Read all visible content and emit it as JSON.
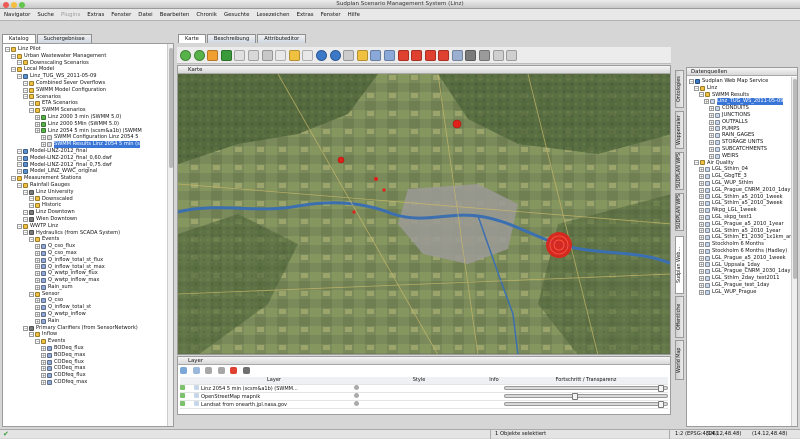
{
  "window": {
    "title": "Sudplan Scenario Management System (Linz)"
  },
  "menu": [
    {
      "label": "Navigator",
      "enabled": true
    },
    {
      "label": "Suche",
      "enabled": true
    },
    {
      "label": "Plugins",
      "enabled": false
    },
    {
      "label": "Extras",
      "enabled": true
    },
    {
      "label": "Fenster",
      "enabled": true
    },
    {
      "label": "Datei",
      "enabled": true
    },
    {
      "label": "Bearbeiten",
      "enabled": true
    },
    {
      "label": "Chronik",
      "enabled": true
    },
    {
      "label": "Gesuchte",
      "enabled": true
    },
    {
      "label": "Lesezeichen",
      "enabled": true
    },
    {
      "label": "Extras",
      "enabled": true
    },
    {
      "label": "Fenster",
      "enabled": true
    },
    {
      "label": "Hilfe",
      "enabled": true
    }
  ],
  "left_tabs": [
    {
      "label": "Katalog"
    },
    {
      "label": "Suchergebnisse"
    }
  ],
  "catalog_tree": [
    {
      "label": "Linz Pilot",
      "level": 0,
      "icon": "folder-icon"
    },
    {
      "label": "Urban Wastewater Management",
      "level": 1,
      "icon": "folder-icon"
    },
    {
      "label": "Downscaling Scenarios",
      "level": 2,
      "icon": "folder-icon"
    },
    {
      "label": "Local Model",
      "level": 1,
      "icon": "folder-icon"
    },
    {
      "label": "Linz_TUG_WS_2011-05-09",
      "level": 2,
      "icon": "model-icon"
    },
    {
      "label": "Combined Sever Overflows",
      "level": 3,
      "icon": "folder-icon"
    },
    {
      "label": "SWMM Model Configuration",
      "level": 3,
      "icon": "folder-icon"
    },
    {
      "label": "Scenarios",
      "level": 3,
      "icon": "folder-icon"
    },
    {
      "label": "ETA Scenarios",
      "level": 4,
      "icon": "folder-icon"
    },
    {
      "label": "SWMM Scenarios",
      "level": 4,
      "icon": "folder-icon"
    },
    {
      "label": "Linz 2000 3 min (SWMM 5.0)",
      "level": 5,
      "icon": "scenario-icon"
    },
    {
      "label": "Linz 2000 5Min (SWMM 5.0)",
      "level": 5,
      "icon": "scenario-icon"
    },
    {
      "label": "Linz 2054 5 min (scsm&a1b) (SWMM",
      "level": 5,
      "icon": "scenario-icon"
    },
    {
      "label": "SWMM Configuration Linz 2054 5",
      "level": 6,
      "icon": "doc-icon"
    },
    {
      "label": "SWMM Results Linz 2054 5 min (s",
      "level": 6,
      "icon": "doc-icon",
      "selected": true
    },
    {
      "label": "Model-LINZ-2012_final",
      "level": 2,
      "icon": "model-icon"
    },
    {
      "label": "Model-LINZ-2012_final_0,60.dwf",
      "level": 2,
      "icon": "model-icon"
    },
    {
      "label": "Model-LINZ-2012_final_0,75.dwf",
      "level": 2,
      "icon": "model-icon"
    },
    {
      "label": "Model_LINZ_WWC_original",
      "level": 2,
      "icon": "model-icon"
    },
    {
      "label": "Measurement Stations",
      "level": 1,
      "icon": "folder-icon"
    },
    {
      "label": "Rainfall Gauges",
      "level": 2,
      "icon": "folder-icon"
    },
    {
      "label": "Linz University",
      "level": 3,
      "icon": "gauge-icon"
    },
    {
      "label": "Downscaled",
      "level": 4,
      "icon": "folder-icon"
    },
    {
      "label": "Historic",
      "level": 4,
      "icon": "folder-icon"
    },
    {
      "label": "Linz Downtown",
      "level": 3,
      "icon": "gauge-icon"
    },
    {
      "label": "Wien Downtown",
      "level": 3,
      "icon": "gauge-icon"
    },
    {
      "label": "WWTP Linz",
      "level": 2,
      "icon": "folder-icon"
    },
    {
      "label": "Hydraulics (from SCADA System)",
      "level": 3,
      "icon": "gauge-icon"
    },
    {
      "label": "Events",
      "level": 4,
      "icon": "folder-icon"
    },
    {
      "label": "Q_cso_flux",
      "level": 5,
      "icon": "series-icon"
    },
    {
      "label": "Q_cso_max",
      "level": 5,
      "icon": "series-icon"
    },
    {
      "label": "Q_inflow_total_st_flux",
      "level": 5,
      "icon": "series-icon"
    },
    {
      "label": "Q_inflow_total_st_max",
      "level": 5,
      "icon": "series-icon"
    },
    {
      "label": "Q_wwtp_inflow_flux",
      "level": 5,
      "icon": "series-icon"
    },
    {
      "label": "Q_wwtp_inflow_max",
      "level": 5,
      "icon": "series-icon"
    },
    {
      "label": "Rain_sum",
      "level": 5,
      "icon": "series-icon"
    },
    {
      "label": "Sensor",
      "level": 4,
      "icon": "folder-icon"
    },
    {
      "label": "Q_cso",
      "level": 5,
      "icon": "series-icon"
    },
    {
      "label": "Q_inflow_total_st",
      "level": 5,
      "icon": "series-icon"
    },
    {
      "label": "Q_wwtp_inflow",
      "level": 5,
      "icon": "series-icon"
    },
    {
      "label": "Rain",
      "level": 5,
      "icon": "series-icon"
    },
    {
      "label": "Primary Clarifiers (from SensorNetwork)",
      "level": 3,
      "icon": "gauge-icon"
    },
    {
      "label": "Inflow",
      "level": 4,
      "icon": "folder-icon"
    },
    {
      "label": "Events",
      "level": 5,
      "icon": "folder-icon"
    },
    {
      "label": "BODeq_flux",
      "level": 6,
      "icon": "series-icon"
    },
    {
      "label": "BODeq_max",
      "level": 6,
      "icon": "series-icon"
    },
    {
      "label": "CODeq_flux",
      "level": 6,
      "icon": "series-icon"
    },
    {
      "label": "CODeq_max",
      "level": 6,
      "icon": "series-icon"
    },
    {
      "label": "CODfeq_flux",
      "level": 6,
      "icon": "series-icon"
    },
    {
      "label": "CODfeq_max",
      "level": 6,
      "icon": "series-icon"
    }
  ],
  "center_tabs": [
    {
      "label": "Karte"
    },
    {
      "label": "Beschreibung"
    },
    {
      "label": "Attributeditor"
    }
  ],
  "toolbar_icons": [
    "back-icon",
    "forward-icon",
    "home-icon",
    "refresh-icon",
    "print-icon",
    "copy-icon",
    "search-icon",
    "zoom-icon",
    "pan-icon",
    "select-icon",
    "info-icon",
    "globe-icon",
    "zoom-in-icon",
    "feature-edit-icon",
    "measure-icon",
    "attribute-icon",
    "new-point-icon",
    "new-line-icon",
    "add-icon",
    "remove-icon",
    "draw-icon",
    "snap-icon",
    "node-icon",
    "undo-icon",
    "redo-icon"
  ],
  "map": {
    "title": "Karte"
  },
  "layer_panel": {
    "title": "Layer",
    "columns": [
      "Layer",
      "Style",
      "Info",
      "Fortschritt / Transparenz"
    ],
    "rows": [
      {
        "name": "Linz 2054 5 min (scsm&a1b) (SWMM...",
        "transparency": 0.98
      },
      {
        "name": "OpenStreetMap mapnik",
        "transparency": 0.45
      },
      {
        "name": "Landsat from onearth.jpl.nasa.gov",
        "transparency": 0.98
      }
    ]
  },
  "right_panel": {
    "title": "Datenquellen"
  },
  "right_vtabs": [
    "Ontologies",
    "Wuppertaler",
    "SUDPLAN WPS",
    "SUDPLAN WPS",
    "Sudplan Web...",
    "Offentliche",
    "World Map"
  ],
  "sources_tree": [
    {
      "label": "Sudplan Web Map Service",
      "level": 0,
      "icon": "server-icon"
    },
    {
      "label": "Linz",
      "level": 1,
      "icon": "folder-icon"
    },
    {
      "label": "SWMM Results",
      "level": 2,
      "icon": "folder-icon"
    },
    {
      "label": "Linz_TUG_WS_2011-05-09",
      "level": 3,
      "icon": "layer-icon",
      "selected": true
    },
    {
      "label": "CONDUITS",
      "level": 4,
      "icon": "layer-icon"
    },
    {
      "label": "JUNCTIONS",
      "level": 4,
      "icon": "layer-icon"
    },
    {
      "label": "OUTFALLS",
      "level": 4,
      "icon": "layer-icon"
    },
    {
      "label": "PUMPS",
      "level": 4,
      "icon": "layer-icon"
    },
    {
      "label": "RAIN_GAGES",
      "level": 4,
      "icon": "layer-icon"
    },
    {
      "label": "STORAGE UNITS",
      "level": 4,
      "icon": "layer-icon"
    },
    {
      "label": "SUBCATCHMENTS",
      "level": 4,
      "icon": "layer-icon"
    },
    {
      "label": "WEIRS",
      "level": 4,
      "icon": "layer-icon"
    },
    {
      "label": "Air Quality",
      "level": 1,
      "icon": "folder-icon"
    },
    {
      "label": "LGL_Sthlm_04",
      "level": 2,
      "icon": "layer-icon"
    },
    {
      "label": "LGL_GbgTE_3",
      "level": 2,
      "icon": "layer-icon"
    },
    {
      "label": "LGL_WUP_Sthlm",
      "level": 2,
      "icon": "layer-icon"
    },
    {
      "label": "LGL_Prague_CNRM_2010_1day",
      "level": 2,
      "icon": "layer-icon"
    },
    {
      "label": "LGL_Sthlm_a5_2010_1week",
      "level": 2,
      "icon": "layer-icon"
    },
    {
      "label": "LGL_Sthlm_a5_2010_3week",
      "level": 2,
      "icon": "layer-icon"
    },
    {
      "label": "Nkpg_LGL_1week",
      "level": 2,
      "icon": "layer-icon"
    },
    {
      "label": "LGL_skpg_test1",
      "level": 2,
      "icon": "layer-icon"
    },
    {
      "label": "LGL_Prague_a5_2010_1year",
      "level": 2,
      "icon": "layer-icon"
    },
    {
      "label": "LGL_Sthlm_a5_2010_1year",
      "level": 2,
      "icon": "layer-icon"
    },
    {
      "label": "LGL_Sthlm_E1_2030_1x1km_ar",
      "level": 2,
      "icon": "layer-icon"
    },
    {
      "label": "Stockholm 6 Months",
      "level": 2,
      "icon": "layer-icon"
    },
    {
      "label": "Stockholm 6 Months (Hadley)",
      "level": 2,
      "icon": "layer-icon"
    },
    {
      "label": "LGL_Prague_a5_2010_1week",
      "level": 2,
      "icon": "layer-icon"
    },
    {
      "label": "LGL_Uppsala_1day",
      "level": 2,
      "icon": "layer-icon"
    },
    {
      "label": "LGL_Prague_CNRM_2030_1day",
      "level": 2,
      "icon": "layer-icon"
    },
    {
      "label": "LGL_Sthlm_2day_test2011",
      "level": 2,
      "icon": "layer-icon"
    },
    {
      "label": "LGL_Prague_test_1day",
      "level": 2,
      "icon": "layer-icon"
    },
    {
      "label": "LGL_WUP_Prague",
      "level": 2,
      "icon": "layer-icon"
    }
  ],
  "status": {
    "message": "1 Objekte selektiert",
    "crs": "1:2 (EPSG:4326)",
    "coord1": "(14.12,48.48)",
    "coord2": "(14.12,48.48)"
  },
  "colors": {
    "accent": "#3875d7",
    "marker": "#e0211a",
    "tab_active": "#ffffff"
  }
}
